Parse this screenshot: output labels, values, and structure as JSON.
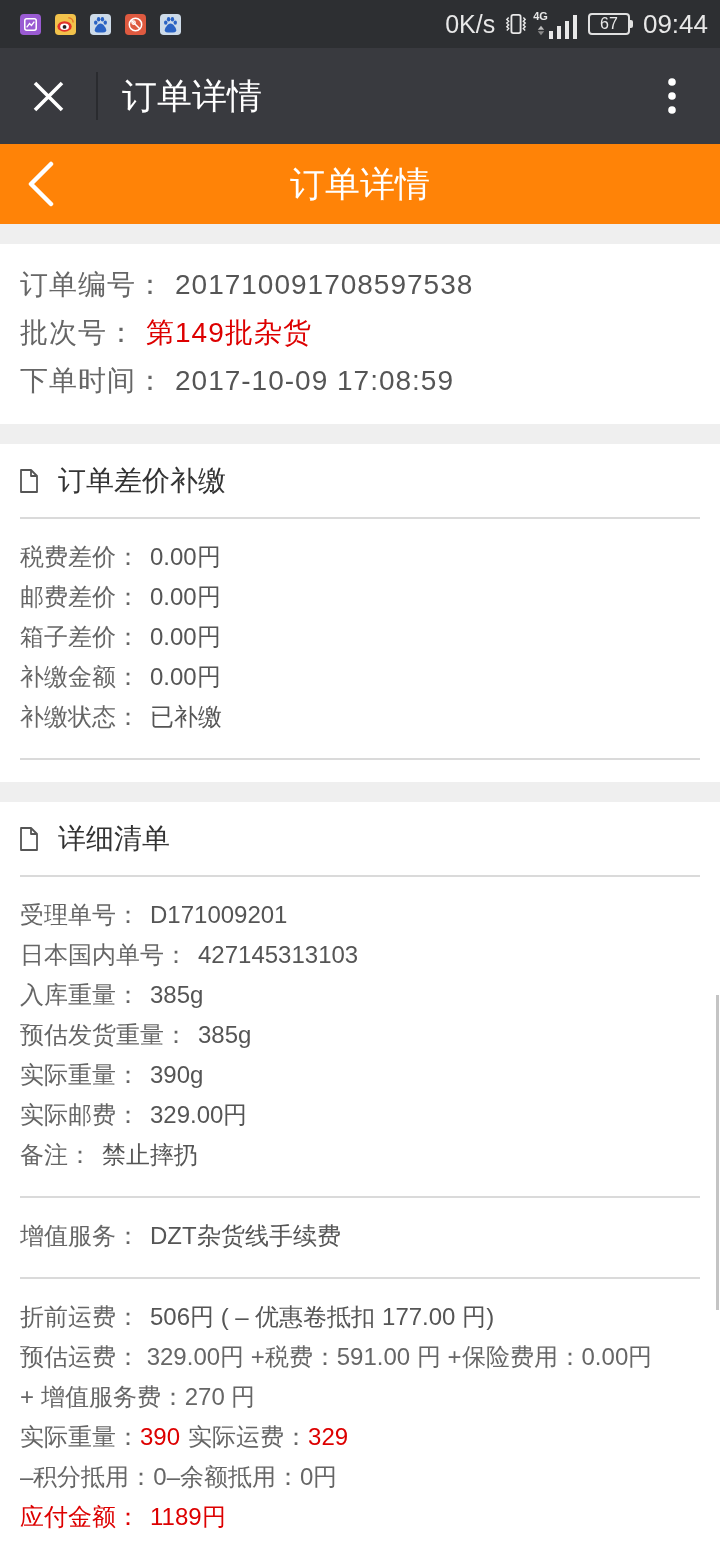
{
  "status_bar": {
    "net_speed": "0K/s",
    "network": "4G",
    "battery": "67",
    "time": "09:44"
  },
  "browser_bar": {
    "title": "订单详情"
  },
  "page_header": {
    "title": "订单详情"
  },
  "order_info": [
    {
      "label": "订单编号：",
      "value": "201710091708597538",
      "label_highlighted": false,
      "value_highlighted": false
    },
    {
      "label": "批次号：",
      "value": "第149批杂货",
      "label_highlighted": false,
      "value_highlighted": true
    },
    {
      "label": "下单时间：",
      "value": "2017-10-09 17:08:59",
      "label_highlighted": false,
      "value_highlighted": false
    }
  ],
  "sections": [
    {
      "title": "订单差价补缴",
      "groups": [
        {
          "rows": [
            {
              "kind": "field",
              "label": "税费差价：",
              "value": "0.00円",
              "label_highlighted": false,
              "value_highlighted": false
            },
            {
              "kind": "field",
              "label": "邮费差价：",
              "value": "0.00円",
              "label_highlighted": false,
              "value_highlighted": false
            },
            {
              "kind": "field",
              "label": "箱子差价：",
              "value": "0.00円",
              "label_highlighted": false,
              "value_highlighted": false
            },
            {
              "kind": "field",
              "label": "补缴金额：",
              "value": "0.00円",
              "label_highlighted": false,
              "value_highlighted": false
            },
            {
              "kind": "field",
              "label": "补缴状态：",
              "value": "已补缴",
              "label_highlighted": false,
              "value_highlighted": false
            }
          ]
        }
      ]
    },
    {
      "title": "详细清单",
      "groups": [
        {
          "rows": [
            {
              "kind": "field",
              "label": "受理单号：",
              "value": "D171009201",
              "label_highlighted": false,
              "value_highlighted": false
            },
            {
              "kind": "field",
              "label": "日本国内单号：",
              "value": "427145313103",
              "label_highlighted": false,
              "value_highlighted": false
            },
            {
              "kind": "field",
              "label": "入库重量：",
              "value": "385g",
              "label_highlighted": false,
              "value_highlighted": false
            },
            {
              "kind": "field",
              "label": "预估发货重量：",
              "value": "385g",
              "label_highlighted": false,
              "value_highlighted": false
            },
            {
              "kind": "field",
              "label": "实际重量：",
              "value": "390g",
              "label_highlighted": false,
              "value_highlighted": false
            },
            {
              "kind": "field",
              "label": "实际邮费：",
              "value": "329.00円",
              "label_highlighted": false,
              "value_highlighted": false
            },
            {
              "kind": "field",
              "label": "备注：",
              "value": "禁止摔扔",
              "label_highlighted": false,
              "value_highlighted": false
            }
          ]
        },
        {
          "rows": [
            {
              "kind": "field",
              "label": "增值服务：",
              "value": "DZT杂货线手续费",
              "label_highlighted": false,
              "value_highlighted": false
            }
          ]
        },
        {
          "rows": [
            {
              "kind": "field",
              "label": "折前运费：",
              "value": "506円 ( – 优惠卷抵扣 177.00 円)",
              "label_highlighted": false,
              "value_highlighted": false
            },
            {
              "kind": "text",
              "text": "预估运费： 329.00円 +税费：591.00 円 +保险费用：0.00円 + 增值服务费：270 円"
            },
            {
              "kind": "pairs",
              "pairs": [
                {
                  "label": "实际重量：",
                  "value": "390",
                  "label_highlighted": false,
                  "value_highlighted": true
                },
                {
                  "label": "实际运费：",
                  "value": "329",
                  "label_highlighted": false,
                  "value_highlighted": true
                }
              ]
            },
            {
              "kind": "text",
              "text": "–积分抵用：0–余额抵用：0円"
            },
            {
              "kind": "field",
              "label": "应付金额：",
              "value": "1189円",
              "label_highlighted": true,
              "value_highlighted": true
            }
          ]
        }
      ]
    }
  ]
}
